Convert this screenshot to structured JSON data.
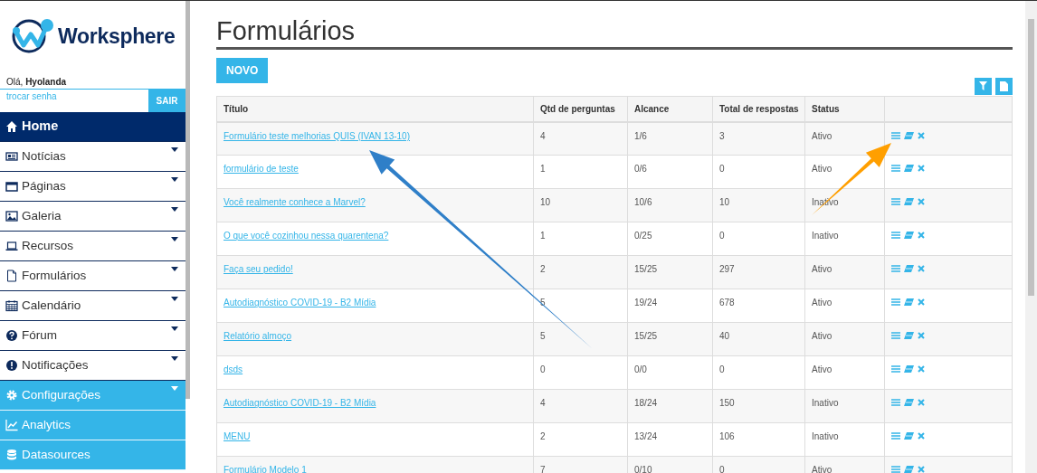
{
  "brand": {
    "name": "Worksphere"
  },
  "user": {
    "greeting": "Olá,",
    "name": "Hyolanda",
    "change_password": "trocar senha",
    "logout": "SAIR"
  },
  "sidebar": {
    "items": [
      {
        "label": "Home",
        "kind": "content",
        "selected": true,
        "has_submenu": false
      },
      {
        "label": "Notícias",
        "kind": "content",
        "selected": false,
        "has_submenu": true
      },
      {
        "label": "Páginas",
        "kind": "content",
        "selected": false,
        "has_submenu": true
      },
      {
        "label": "Galeria",
        "kind": "content",
        "selected": false,
        "has_submenu": true
      },
      {
        "label": "Recursos",
        "kind": "content",
        "selected": false,
        "has_submenu": true
      },
      {
        "label": "Formulários",
        "kind": "content",
        "selected": false,
        "has_submenu": true
      },
      {
        "label": "Calendário",
        "kind": "content",
        "selected": false,
        "has_submenu": true
      },
      {
        "label": "Fórum",
        "kind": "content",
        "selected": false,
        "has_submenu": true
      },
      {
        "label": "Notificações",
        "kind": "content",
        "selected": false,
        "has_submenu": true
      },
      {
        "label": "Configurações",
        "kind": "admin",
        "selected": false,
        "has_submenu": true
      },
      {
        "label": "Analytics",
        "kind": "admin",
        "selected": false,
        "has_submenu": false
      },
      {
        "label": "Datasources",
        "kind": "admin",
        "selected": false,
        "has_submenu": false
      }
    ]
  },
  "page": {
    "title": "Formulários",
    "new_button": "NOVO"
  },
  "table": {
    "columns": [
      "Título",
      "Qtd de perguntas",
      "Alcance",
      "Total de respostas",
      "Status"
    ],
    "rows": [
      {
        "title": "Formulário teste melhorias QUIS (IVAN 13-10)",
        "questions": "4",
        "reach": "1/6",
        "responses": "3",
        "status": "Ativo"
      },
      {
        "title": "formulário de teste",
        "questions": "1",
        "reach": "0/6",
        "responses": "0",
        "status": "Ativo"
      },
      {
        "title": "Você realmente conhece a Marvel?",
        "questions": "10",
        "reach": "10/6",
        "responses": "10",
        "status": "Inativo"
      },
      {
        "title": "O que você cozinhou nessa quarentena?",
        "questions": "1",
        "reach": "0/25",
        "responses": "0",
        "status": "Inativo"
      },
      {
        "title": "Faça seu pedido!",
        "questions": "2",
        "reach": "15/25",
        "responses": "297",
        "status": "Ativo"
      },
      {
        "title": "Autodiagnóstico COVID-19 - B2 Mídia",
        "questions": "5",
        "reach": "19/24",
        "responses": "678",
        "status": "Ativo"
      },
      {
        "title": "Relatório almoço",
        "questions": "5",
        "reach": "15/25",
        "responses": "40",
        "status": "Ativo"
      },
      {
        "title": "dsds",
        "questions": "0",
        "reach": "0/0",
        "responses": "0",
        "status": "Ativo"
      },
      {
        "title": "Autodiagnóstico COVID-19 - B2 Mídia",
        "questions": "4",
        "reach": "18/24",
        "responses": "150",
        "status": "Inativo"
      },
      {
        "title": "MENU",
        "questions": "2",
        "reach": "13/24",
        "responses": "106",
        "status": "Inativo"
      },
      {
        "title": "Formulário Modelo 1",
        "questions": "7",
        "reach": "0/10",
        "responses": "0",
        "status": "Ativo"
      }
    ]
  },
  "annotations": [
    {
      "kind": "arrow",
      "color": "#2f7fc8"
    },
    {
      "kind": "arrow",
      "color": "#ff9f00"
    }
  ]
}
